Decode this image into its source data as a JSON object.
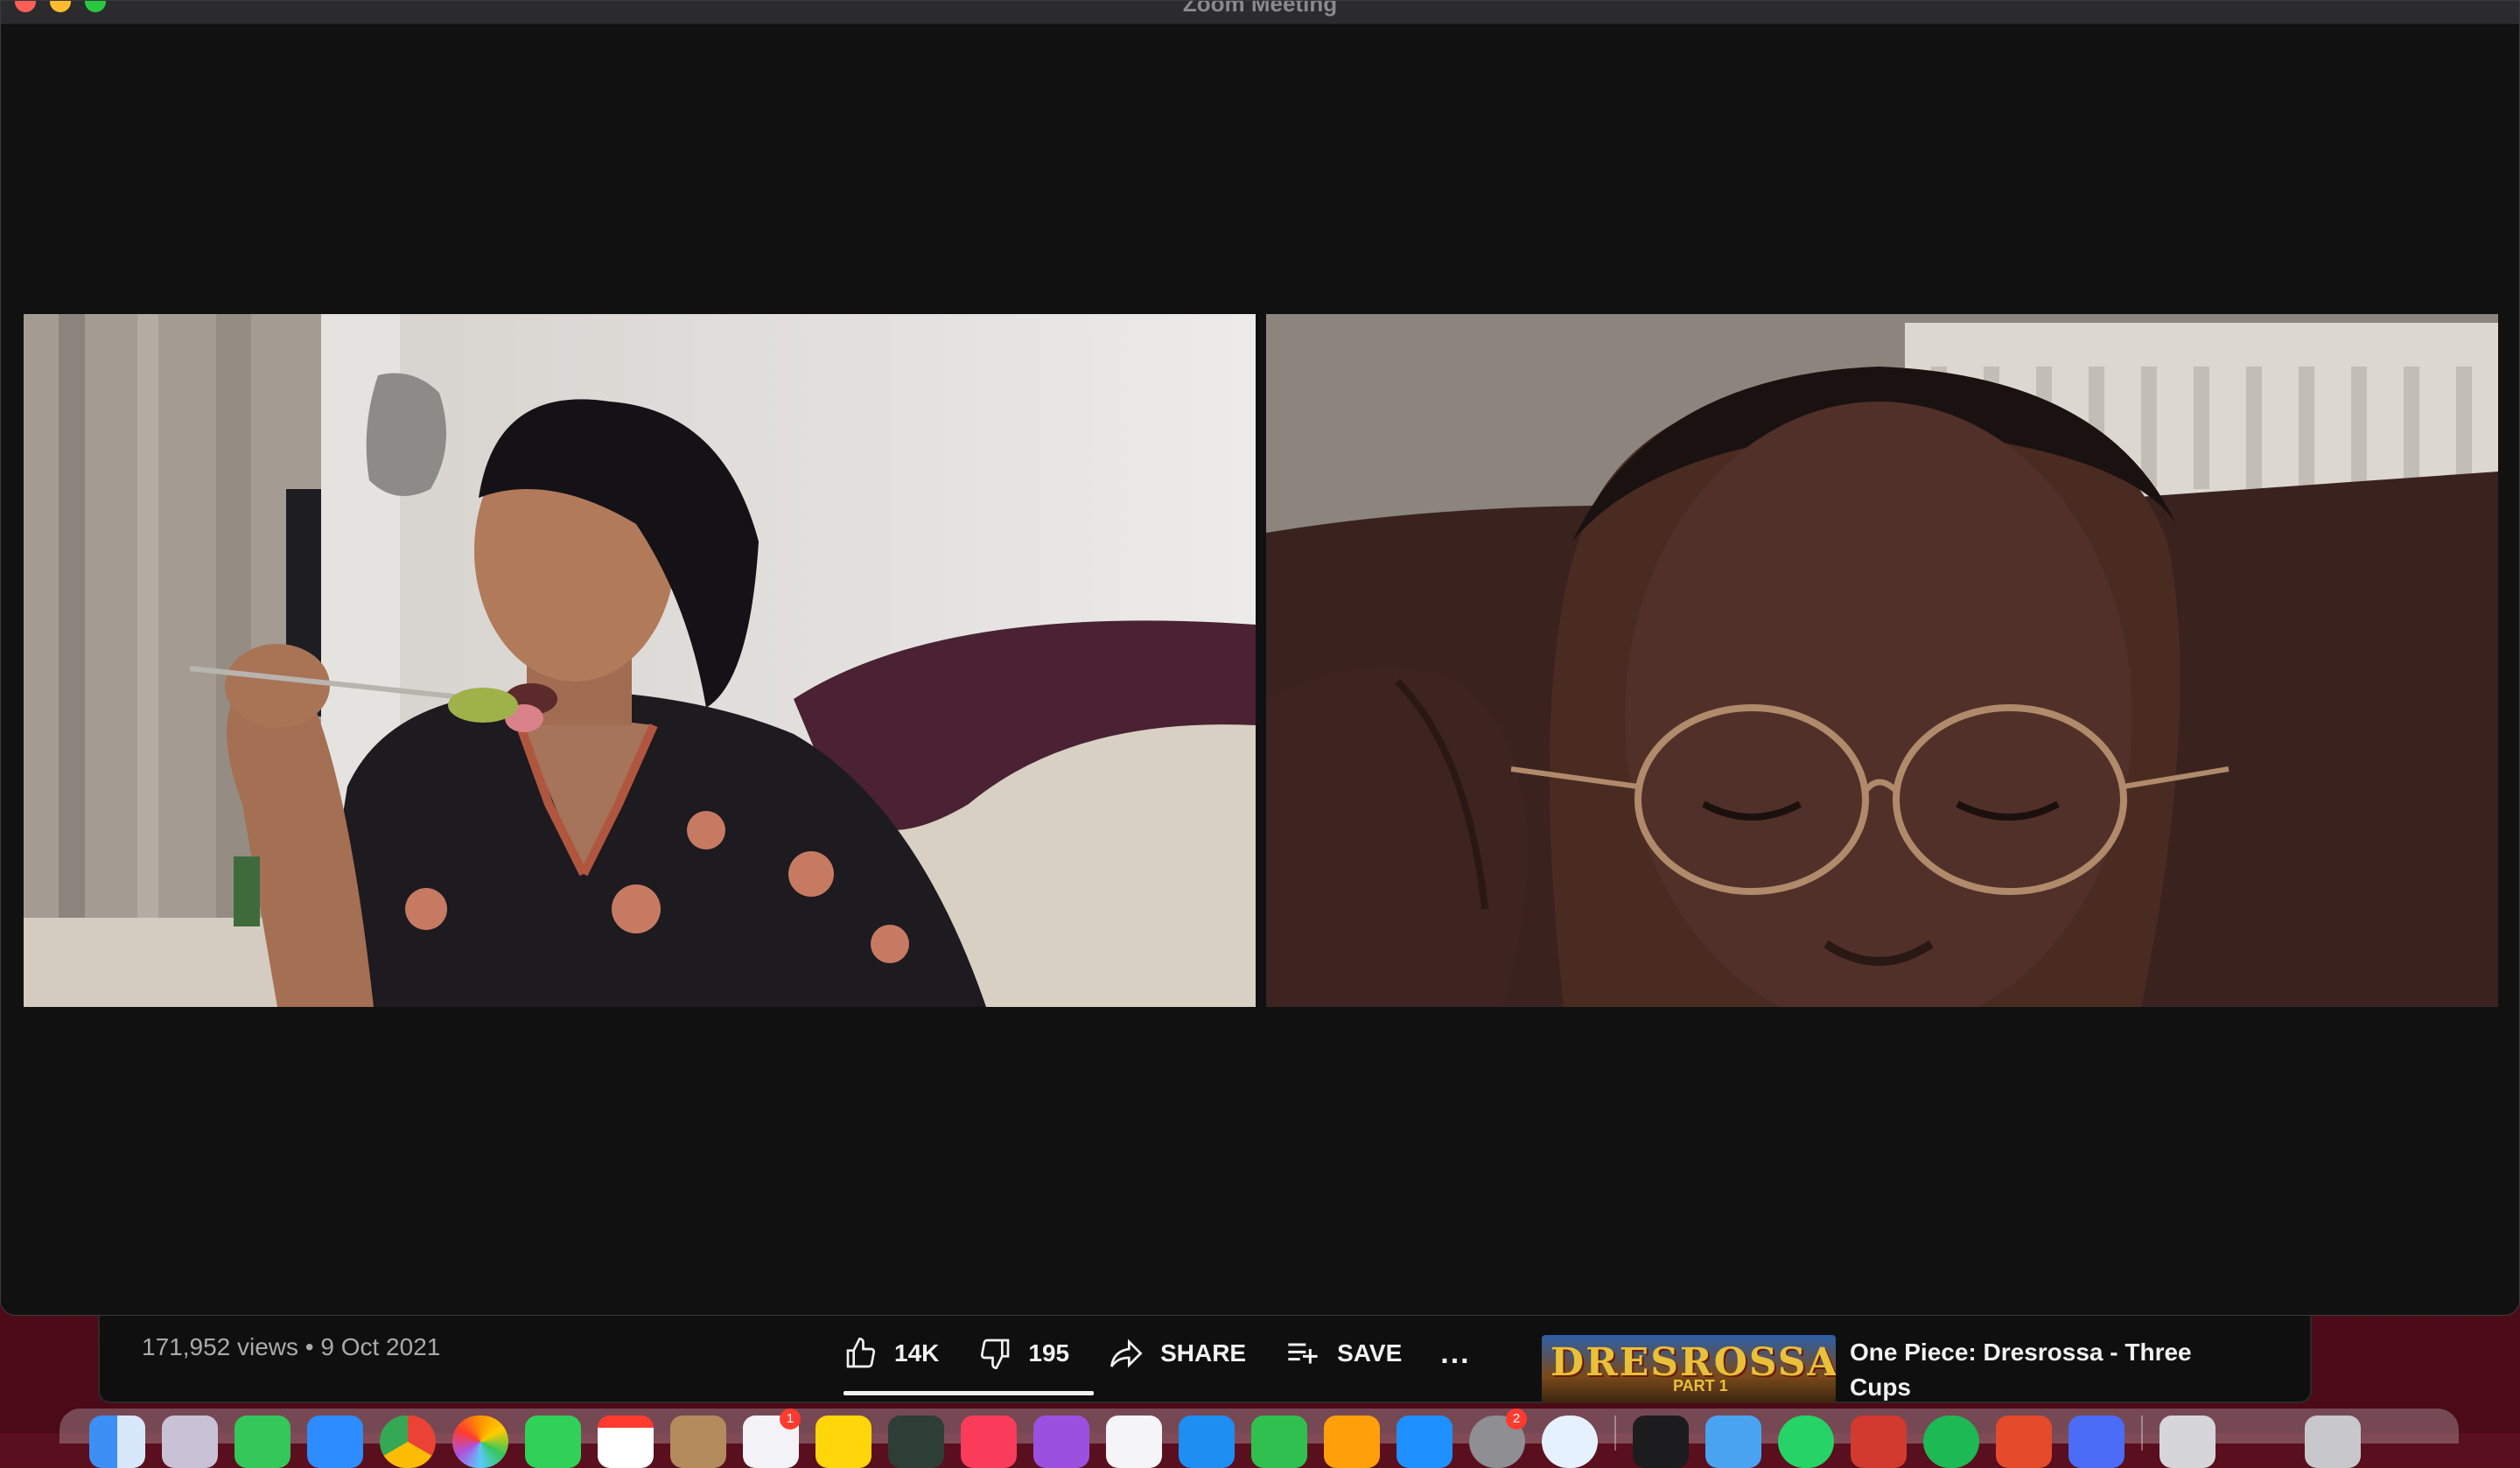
{
  "window": {
    "title": "Zoom Meeting"
  },
  "participants": [
    {
      "id": "participant-1",
      "description_icon": "video-feed"
    },
    {
      "id": "participant-2",
      "description_icon": "video-feed"
    }
  ],
  "background_page": {
    "views_date": "171,952 views • 9 Oct 2021",
    "like_count": "14K",
    "dislike_count": "195",
    "share_label": "SHARE",
    "save_label": "SAVE",
    "more_label": "...",
    "recommended": {
      "thumbnail_text": "DRESROSSA",
      "thumbnail_sub": "PART 1",
      "title": "One Piece: Dresrossa - Three Cups"
    }
  },
  "dock": {
    "badges": {
      "mail": "1",
      "chat": "2"
    }
  },
  "colors": {
    "zoom_bg": "#111112",
    "titlebar": "#2b2b2d",
    "youtube_bg": "#0f0f0f",
    "wallpaper": "#5a0f1e"
  }
}
